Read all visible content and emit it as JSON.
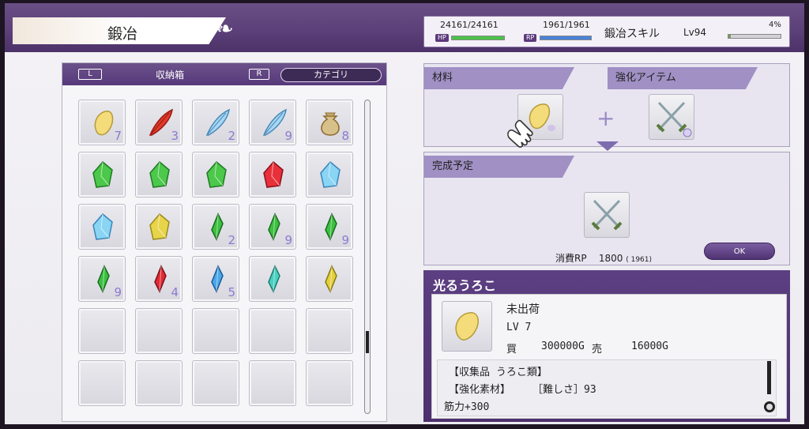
{
  "header": {
    "title": "鍛冶",
    "hp_label": "HP",
    "hp_value": "24161/24161",
    "hp_fraction": 1.0,
    "rp_label": "RP",
    "rp_value": "1961/1961",
    "rp_fraction": 1.0,
    "skill_label": "鍛冶スキル",
    "skill_level": "Lv94",
    "skill_exp": "4%",
    "skill_fraction": 0.04
  },
  "storage": {
    "l_key": "L",
    "title": "収納箱",
    "r_key": "R",
    "category_label": "カテゴリ",
    "items": [
      {
        "icon": "yellow-scale-icon",
        "qty": "7"
      },
      {
        "icon": "red-feather-icon",
        "qty": "3"
      },
      {
        "icon": "blue-feather-icon",
        "qty": "2"
      },
      {
        "icon": "blue-feather-icon",
        "qty": "9"
      },
      {
        "icon": "pouch-icon",
        "qty": "8"
      },
      {
        "icon": "green-crystal-icon",
        "qty": ""
      },
      {
        "icon": "green-crystal-icon",
        "qty": ""
      },
      {
        "icon": "green-crystal-icon",
        "qty": ""
      },
      {
        "icon": "red-crystal-icon",
        "qty": ""
      },
      {
        "icon": "blue-crystal-icon",
        "qty": ""
      },
      {
        "icon": "blue-crystal-icon",
        "qty": ""
      },
      {
        "icon": "yellow-crystal-icon",
        "qty": ""
      },
      {
        "icon": "green-shard-icon",
        "qty": "2"
      },
      {
        "icon": "green-shard-icon",
        "qty": "9"
      },
      {
        "icon": "green-shard-icon",
        "qty": "9"
      },
      {
        "icon": "green-shard-icon",
        "qty": "9"
      },
      {
        "icon": "red-shard-icon",
        "qty": "4"
      },
      {
        "icon": "blue-shard-icon",
        "qty": "5"
      },
      {
        "icon": "cyan-shard-icon",
        "qty": ""
      },
      {
        "icon": "yellow-shard-icon",
        "qty": ""
      },
      {
        "icon": "",
        "qty": ""
      },
      {
        "icon": "",
        "qty": ""
      },
      {
        "icon": "",
        "qty": ""
      },
      {
        "icon": "",
        "qty": ""
      },
      {
        "icon": "",
        "qty": ""
      },
      {
        "icon": "",
        "qty": ""
      },
      {
        "icon": "",
        "qty": ""
      },
      {
        "icon": "",
        "qty": ""
      },
      {
        "icon": "",
        "qty": ""
      },
      {
        "icon": "",
        "qty": ""
      }
    ]
  },
  "crafting": {
    "material_label": "材料",
    "enhance_label": "強化アイテム",
    "material_icon": "yellow-scale-icon",
    "enhance_icon": "crossed-swords-icon",
    "plus": "+",
    "result_label": "完成予定",
    "result_icon": "crossed-swords-icon",
    "cost_label": "消費RP",
    "cost_value": "1800",
    "cost_available": "( 1961)",
    "ok_label": "OK"
  },
  "info": {
    "name": "光るうろこ",
    "icon": "yellow-scale-icon",
    "status": "未出荷",
    "level": "LV 7",
    "buy_label": "買",
    "buy_price": "300000G",
    "sell_label": "売",
    "sell_price": "16000G",
    "category": "【収集品 うろこ類】",
    "enhance_type": "【強化素材】",
    "difficulty": "［難しさ］93",
    "effect": "筋力+300",
    "stick_label": "R"
  },
  "colors": {
    "header_purple": "#5a3f78",
    "hp_green": "#4cc24a",
    "rp_blue": "#4a82d8",
    "quantity_purple": "#8d7ad0"
  }
}
